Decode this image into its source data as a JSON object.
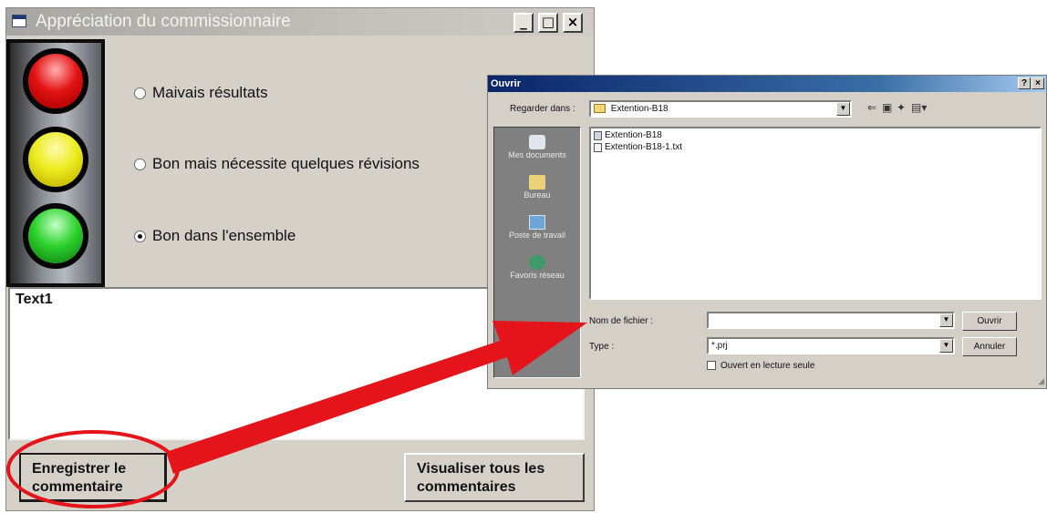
{
  "main_window": {
    "title": "Appréciation du commissionnaire",
    "controls": {
      "minimize": "_",
      "maximize": "□",
      "close": "×"
    },
    "radios": [
      {
        "label": "Maivais résultats",
        "checked": false
      },
      {
        "label": "Bon mais nécessite quelques révisions",
        "checked": false
      },
      {
        "label": "Bon dans l'ensemble",
        "checked": true
      }
    ],
    "text_box": "Text1",
    "buttons": {
      "save_line1": "Enregistrer le",
      "save_line2": "commentaire",
      "view_line1": "Visualiser tous les",
      "view_line2": "commentaires"
    }
  },
  "open_dialog": {
    "title": "Ouvrir",
    "title_buttons": {
      "help": "?",
      "close": "×"
    },
    "look_in_label": "Regarder dans :",
    "look_in_value": "Extention-B18",
    "places": [
      "Mes documents",
      "Bureau",
      "Poste de travail",
      "Favoris réseau"
    ],
    "files": [
      "Extention-B18",
      "Extention-B18-1.txt"
    ],
    "filename_label": "Nom de fichier :",
    "filename_value": "",
    "type_label": "Type :",
    "type_value": "*.prj",
    "open_button": "Ouvrir",
    "cancel_button": "Annuler",
    "readonly_checkbox": "Ouvert en lecture seule"
  },
  "colors": {
    "annotation_red": "#e4141a",
    "dialog_title_blue": "#0a246a"
  }
}
